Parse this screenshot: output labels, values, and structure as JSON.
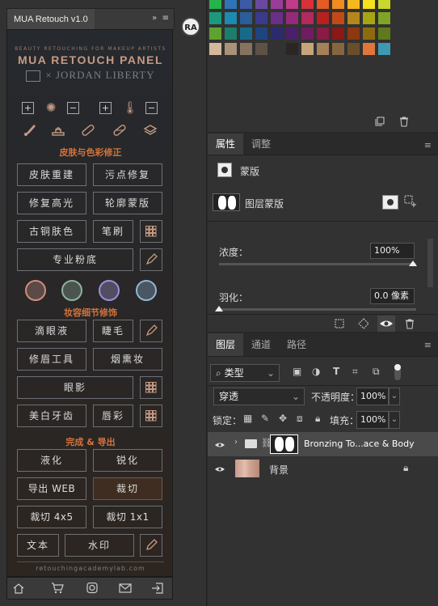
{
  "left_panel": {
    "tab_title": "MUA Retouch v1.0",
    "panel_controls": "»",
    "tagline": "BEAUTY RETOUCHING FOR MAKEUP ARTISTS",
    "brand": "MUA RETOUCH PANEL",
    "partner": "× JORDAN LIBERTY",
    "sec1": "皮肤与色彩修正",
    "sec2": "妆容细节修饰",
    "sec3": "完成 & 导出",
    "btns": {
      "b1": "皮肤重建",
      "b2": "污点修复",
      "b3": "修复高光",
      "b4": "轮廓蒙版",
      "b5": "古铜肤色",
      "b6": "笔刷",
      "b7": "专业粉底",
      "b8": "滴眼液",
      "b9": "睫毛",
      "b10": "修眉工具",
      "b11": "烟熏妆",
      "b12": "眼影",
      "b13": "美白牙齿",
      "b14": "唇彩",
      "b15": "液化",
      "b16": "锐化",
      "b17": "导出 WEB",
      "b18": "裁切",
      "b19": "裁切 4x5",
      "b20": "裁切 1x1",
      "b21": "文本",
      "b22": "水印"
    },
    "footer_url": "retouchingacademylab.com"
  },
  "avatar": "RA",
  "properties": {
    "tab_props": "属性",
    "tab_adjust": "调整",
    "mask_label": "蒙版",
    "layer_mask": "图层蒙版",
    "density_label": "浓度：",
    "density_value": "100%",
    "feather_label": "羽化：",
    "feather_value": "0.0 像素"
  },
  "layers": {
    "tab_layers": "图层",
    "tab_channels": "通道",
    "tab_paths": "路径",
    "filter_kind": "类型",
    "blend_mode": "穿透",
    "opacity_label": "不透明度：",
    "opacity_value": "100%",
    "lock_label": "锁定：",
    "fill_label": "填充：",
    "fill_value": "100%",
    "items": [
      {
        "name": "Bronzing To...ace & Body"
      },
      {
        "name": "背景"
      }
    ]
  },
  "colors": {
    "accent": "#d6733b",
    "brand": "#c59a84"
  }
}
